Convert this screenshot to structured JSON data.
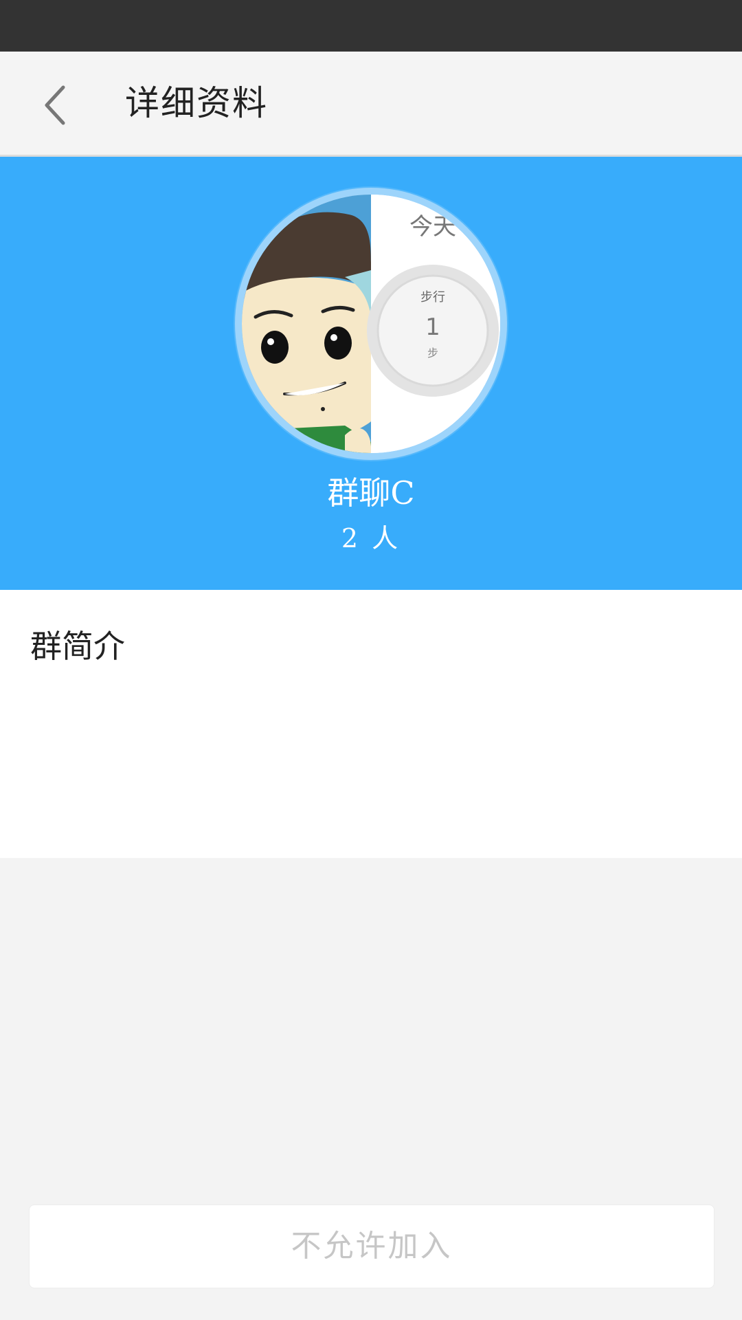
{
  "header": {
    "title": "详细资料",
    "back_icon": "chevron-left-icon"
  },
  "group": {
    "name": "群聊C",
    "member_count": "2 人",
    "avatar": {
      "today_label": "今天",
      "walk_label": "步行",
      "steps_value": "1",
      "steps_unit": "步"
    }
  },
  "intro": {
    "heading": "群简介",
    "text": ""
  },
  "join_button": {
    "label": "不允许加入"
  },
  "colors": {
    "status_bar": "#333333",
    "header_bg": "#f4f4f4",
    "hero_bg": "#38acfb",
    "button_text_disabled": "#c6c6c6"
  }
}
